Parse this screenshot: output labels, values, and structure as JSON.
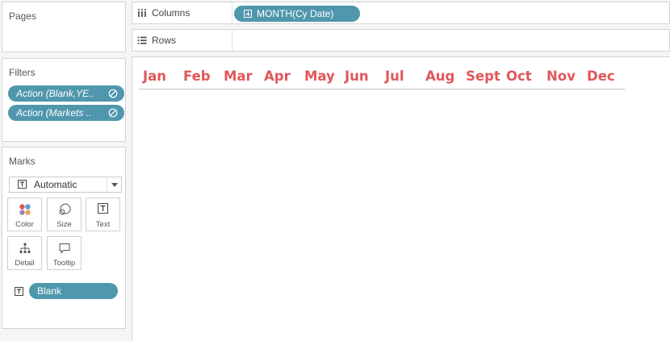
{
  "pages": {
    "title": "Pages"
  },
  "filters": {
    "title": "Filters",
    "items": [
      {
        "label": "Action (Blank,YE.."
      },
      {
        "label": "Action (Markets .."
      }
    ]
  },
  "marks": {
    "title": "Marks",
    "mark_type": "Automatic",
    "buttons": {
      "color": "Color",
      "size": "Size",
      "text": "Text",
      "detail": "Detail",
      "tooltip": "Tooltip"
    },
    "fields": [
      {
        "label": "Blank",
        "encoding": "text"
      }
    ]
  },
  "shelves": {
    "columns": {
      "label": "Columns",
      "pill": "MONTH(Cy Date)"
    },
    "rows": {
      "label": "Rows"
    }
  },
  "viz": {
    "months": [
      "Jan",
      "Feb",
      "Mar",
      "Apr",
      "May",
      "Jun",
      "Jul",
      "Aug",
      "Sept",
      "Oct",
      "Nov",
      "Dec"
    ],
    "month_color": "#e0575a"
  },
  "colors": {
    "pill_blue": "#4f97ad",
    "header_red": "#e0575a"
  }
}
